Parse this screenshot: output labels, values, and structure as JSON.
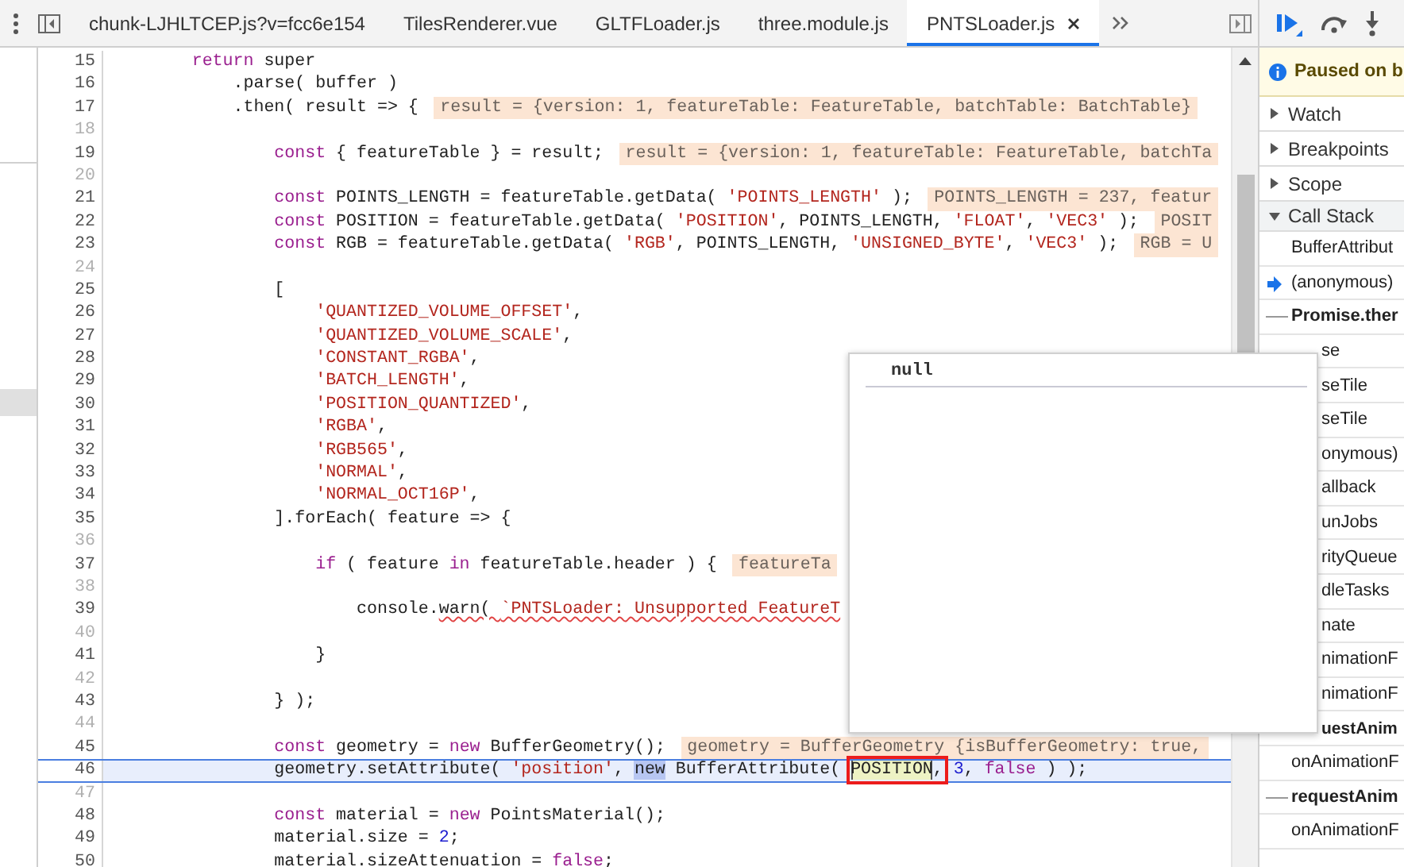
{
  "editor_tabs": [
    {
      "label": "chunk-LJHLTCEP.js?v=fcc6e154",
      "selected": false
    },
    {
      "label": "TilesRenderer.vue",
      "selected": false
    },
    {
      "label": "GLTFLoader.js",
      "selected": false
    },
    {
      "label": "three.module.js",
      "selected": false
    },
    {
      "label": "PNTSLoader.js",
      "selected": true
    }
  ],
  "code_lines": [
    {
      "number": "15",
      "kind": "code",
      "tokens": [
        {
          "kind": "kw",
          "text": "        return"
        },
        {
          "kind": "plain",
          "text": " super"
        }
      ]
    },
    {
      "number": "16",
      "kind": "code",
      "tokens": [
        {
          "kind": "plain",
          "text": "            .parse( buffer )"
        }
      ]
    },
    {
      "number": "17",
      "kind": "code",
      "tokens": [
        {
          "kind": "plain",
          "text": "            .then( result => {"
        }
      ],
      "annotation": "result = {version: 1, featureTable: FeatureTable, batchTable: BatchTable}"
    },
    {
      "number": "18",
      "kind": "code"
    },
    {
      "number": "19",
      "kind": "code",
      "tokens": [
        {
          "kind": "kw",
          "text": "                const"
        },
        {
          "kind": "plain",
          "text": " { featureTable } = result;"
        }
      ],
      "annotation": "result = {version: 1, featureTable: FeatureTable, batchTa"
    },
    {
      "number": "20",
      "kind": "code"
    },
    {
      "number": "21",
      "kind": "code",
      "tokens": [
        {
          "kind": "kw",
          "text": "                const"
        },
        {
          "kind": "plain",
          "text": " POINTS_LENGTH = featureTable.getData( "
        },
        {
          "kind": "str",
          "text": "'POINTS_LENGTH'"
        },
        {
          "kind": "plain",
          "text": " );"
        }
      ],
      "annotation": "POINTS_LENGTH = 237, featur"
    },
    {
      "number": "22",
      "kind": "code",
      "tokens": [
        {
          "kind": "kw",
          "text": "                const"
        },
        {
          "kind": "plain",
          "text": " POSITION = featureTable.getData( "
        },
        {
          "kind": "str",
          "text": "'POSITION'"
        },
        {
          "kind": "plain",
          "text": ", POINTS_LENGTH, "
        },
        {
          "kind": "str",
          "text": "'FLOAT'"
        },
        {
          "kind": "plain",
          "text": ", "
        },
        {
          "kind": "str",
          "text": "'VEC3'"
        },
        {
          "kind": "plain",
          "text": " );"
        }
      ],
      "annotation": "POSIT"
    },
    {
      "number": "23",
      "kind": "code",
      "tokens": [
        {
          "kind": "kw",
          "text": "                const"
        },
        {
          "kind": "plain",
          "text": " RGB = featureTable.getData( "
        },
        {
          "kind": "str",
          "text": "'RGB'"
        },
        {
          "kind": "plain",
          "text": ", POINTS_LENGTH, "
        },
        {
          "kind": "str",
          "text": "'UNSIGNED_BYTE'"
        },
        {
          "kind": "plain",
          "text": ", "
        },
        {
          "kind": "str",
          "text": "'VEC3'"
        },
        {
          "kind": "plain",
          "text": " );"
        }
      ],
      "annotation": "RGB = U"
    },
    {
      "number": "24",
      "kind": "code"
    },
    {
      "number": "25",
      "kind": "code",
      "tokens": [
        {
          "kind": "plain",
          "text": "                ["
        }
      ]
    },
    {
      "number": "26",
      "kind": "code",
      "tokens": [
        {
          "kind": "str",
          "text": "                    'QUANTIZED_VOLUME_OFFSET'"
        },
        {
          "kind": "plain",
          "text": ","
        }
      ]
    },
    {
      "number": "27",
      "kind": "code",
      "tokens": [
        {
          "kind": "str",
          "text": "                    'QUANTIZED_VOLUME_SCALE'"
        },
        {
          "kind": "plain",
          "text": ","
        }
      ]
    },
    {
      "number": "28",
      "kind": "code",
      "tokens": [
        {
          "kind": "str",
          "text": "                    'CONSTANT_RGBA'"
        },
        {
          "kind": "plain",
          "text": ","
        }
      ]
    },
    {
      "number": "29",
      "kind": "code",
      "tokens": [
        {
          "kind": "str",
          "text": "                    'BATCH_LENGTH'"
        },
        {
          "kind": "plain",
          "text": ","
        }
      ]
    },
    {
      "number": "30",
      "kind": "code",
      "tokens": [
        {
          "kind": "str",
          "text": "                    'POSITION_QUANTIZED'"
        },
        {
          "kind": "plain",
          "text": ","
        }
      ]
    },
    {
      "number": "31",
      "kind": "code",
      "tokens": [
        {
          "kind": "str",
          "text": "                    'RGBA'"
        },
        {
          "kind": "plain",
          "text": ","
        }
      ]
    },
    {
      "number": "32",
      "kind": "code",
      "tokens": [
        {
          "kind": "str",
          "text": "                    'RGB565'"
        },
        {
          "kind": "plain",
          "text": ","
        }
      ]
    },
    {
      "number": "33",
      "kind": "code",
      "tokens": [
        {
          "kind": "str",
          "text": "                    'NORMAL'"
        },
        {
          "kind": "plain",
          "text": ","
        }
      ]
    },
    {
      "number": "34",
      "kind": "code",
      "tokens": [
        {
          "kind": "str",
          "text": "                    'NORMAL_OCT16P'"
        },
        {
          "kind": "plain",
          "text": ","
        }
      ]
    },
    {
      "number": "35",
      "kind": "code",
      "tokens": [
        {
          "kind": "plain",
          "text": "                ].forEach( feature => {"
        }
      ]
    },
    {
      "number": "36",
      "kind": "code"
    },
    {
      "number": "37",
      "kind": "code",
      "tokens": [
        {
          "kind": "kw",
          "text": "                    if"
        },
        {
          "kind": "plain",
          "text": " ( feature "
        },
        {
          "kind": "kw",
          "text": "in"
        },
        {
          "kind": "plain",
          "text": " featureTable.header ) {"
        }
      ],
      "annotation": "featureTa"
    },
    {
      "number": "38",
      "kind": "code"
    },
    {
      "number": "39",
      "kind": "code",
      "tokens": [
        {
          "kind": "plain",
          "text": "                        console."
        },
        {
          "kind": "squiggle",
          "text": "warn( "
        },
        {
          "kind": "squigglestr",
          "text": "`PNTSLoader: Unsupported FeatureT"
        }
      ]
    },
    {
      "number": "40",
      "kind": "code"
    },
    {
      "number": "41",
      "kind": "code",
      "tokens": [
        {
          "kind": "plain",
          "text": "                    }"
        }
      ]
    },
    {
      "number": "42",
      "kind": "code"
    },
    {
      "number": "43",
      "kind": "code",
      "tokens": [
        {
          "kind": "plain",
          "text": "                } );"
        }
      ]
    },
    {
      "number": "44",
      "kind": "code"
    },
    {
      "number": "45",
      "kind": "code",
      "tokens": [
        {
          "kind": "kw",
          "text": "                const"
        },
        {
          "kind": "plain",
          "text": " geometry = "
        },
        {
          "kind": "kw",
          "text": "new"
        },
        {
          "kind": "plain",
          "text": " BufferGeometry();"
        }
      ],
      "annotation": "geometry = BufferGeometry {isBufferGeometry: true,"
    },
    {
      "number": "46",
      "kind": "current",
      "tokens": [
        {
          "kind": "plain",
          "text": "                geometry.setAttribute( "
        },
        {
          "kind": "str",
          "text": "'position'"
        },
        {
          "kind": "plain",
          "text": ", "
        },
        {
          "kind": "sel",
          "text": "new"
        },
        {
          "kind": "plain",
          "text": " BufferAttribute( "
        },
        {
          "kind": "hover",
          "text": "POSITION"
        },
        {
          "kind": "plain",
          "text": ", "
        },
        {
          "kind": "num",
          "text": "3"
        },
        {
          "kind": "plain",
          "text": ", "
        },
        {
          "kind": "kw",
          "text": "false"
        },
        {
          "kind": "plain",
          "text": " ) );"
        }
      ]
    },
    {
      "number": "47",
      "kind": "code"
    },
    {
      "number": "48",
      "kind": "code",
      "tokens": [
        {
          "kind": "kw",
          "text": "                const"
        },
        {
          "kind": "plain",
          "text": " material = "
        },
        {
          "kind": "kw",
          "text": "new"
        },
        {
          "kind": "plain",
          "text": " PointsMaterial();"
        }
      ]
    },
    {
      "number": "49",
      "kind": "code",
      "tokens": [
        {
          "kind": "plain",
          "text": "                material.size = "
        },
        {
          "kind": "num",
          "text": "2"
        },
        {
          "kind": "plain",
          "text": ";"
        }
      ]
    },
    {
      "number": "50",
      "kind": "code",
      "tokens": [
        {
          "kind": "plain",
          "text": "                material.sizeAttenuation = "
        },
        {
          "kind": "kw",
          "text": "false"
        },
        {
          "kind": "plain",
          "text": ";"
        }
      ]
    }
  ],
  "value_popover": {
    "value": "null"
  },
  "debugger": {
    "status": "Paused on b",
    "sections": [
      {
        "label": "Watch",
        "expanded": false
      },
      {
        "label": "Breakpoints",
        "expanded": false
      },
      {
        "label": "Scope",
        "expanded": false
      },
      {
        "label": "Call Stack",
        "expanded": true
      }
    ],
    "call_stack": [
      {
        "text": "BufferAttribut",
        "kind": "frame"
      },
      {
        "text": "(anonymous)",
        "kind": "current"
      },
      {
        "text": "Promise.ther",
        "kind": "async"
      },
      {
        "text": "se",
        "kind": "partial"
      },
      {
        "text": "seTile",
        "kind": "partial"
      },
      {
        "text": "seTile",
        "kind": "partial"
      },
      {
        "text": "onymous)",
        "kind": "partial"
      },
      {
        "text": "allback",
        "kind": "partial"
      },
      {
        "text": "unJobs",
        "kind": "partial"
      },
      {
        "text": "rityQueue",
        "kind": "partial"
      },
      {
        "text": "dleTasks",
        "kind": "partial"
      },
      {
        "text": "nate",
        "kind": "partial"
      },
      {
        "text": "nimationF",
        "kind": "partial"
      },
      {
        "text": "nimationF",
        "kind": "partial"
      },
      {
        "text": "uestAnim",
        "kind": "partialasync"
      },
      {
        "text": "onAnimationF",
        "kind": "frame"
      },
      {
        "text": "requestAnim",
        "kind": "async"
      },
      {
        "text": "onAnimationF",
        "kind": "frame"
      }
    ]
  }
}
